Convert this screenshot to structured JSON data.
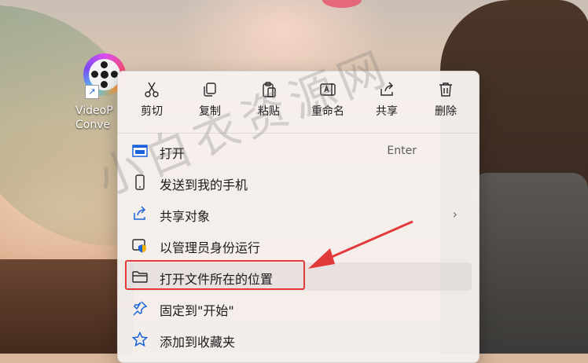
{
  "desktop": {
    "icon_label": "VideoP\nConve"
  },
  "menu": {
    "toolbar": [
      {
        "label": "剪切",
        "icon": "scissors-icon"
      },
      {
        "label": "复制",
        "icon": "copy-icon"
      },
      {
        "label": "粘贴",
        "icon": "clipboard-icon"
      },
      {
        "label": "重命名",
        "icon": "rename-icon"
      },
      {
        "label": "共享",
        "icon": "share-icon"
      },
      {
        "label": "删除",
        "icon": "trash-icon"
      }
    ],
    "items": [
      {
        "label": "打开",
        "shortcut": "Enter",
        "icon": "open-window-icon"
      },
      {
        "label": "发送到我的手机",
        "icon": "phone-icon"
      },
      {
        "label": "共享对象",
        "submenu_chevron": "›",
        "icon": "share-icon"
      },
      {
        "label": "以管理员身份运行",
        "icon": "shield-icon"
      },
      {
        "label": "打开文件所在的位置",
        "icon": "folder-icon",
        "highlighted": true
      },
      {
        "label": "固定到\"开始\"",
        "icon": "pin-icon"
      },
      {
        "label": "添加到收藏夹",
        "icon": "star-icon"
      }
    ]
  },
  "watermark": "小白衣资源网",
  "colors": {
    "highlight_box": "#e23a3a",
    "arrow": "#e23a3a",
    "accent_blue": "#1a63d8"
  }
}
